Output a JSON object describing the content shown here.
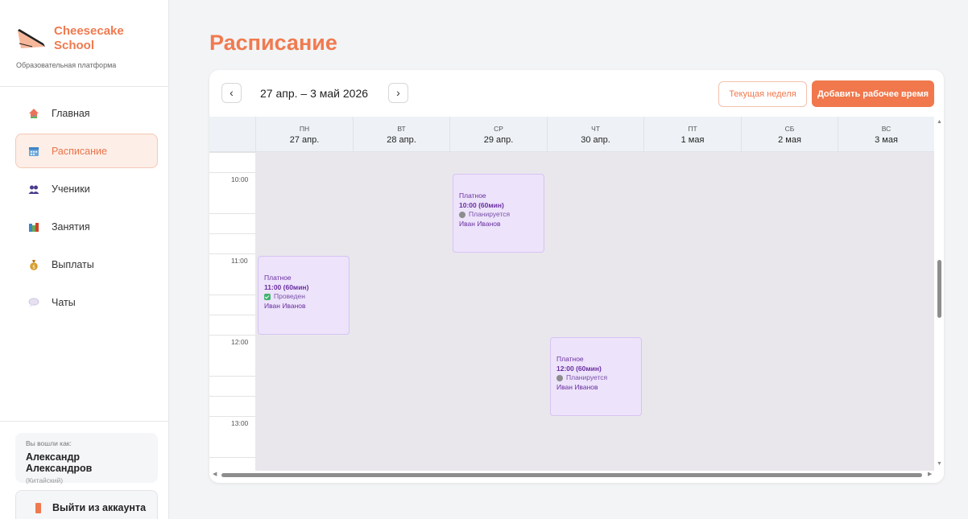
{
  "brand": {
    "name_line1": "Cheesecake",
    "name_line2": "School",
    "subtitle": "Образовательная платформа",
    "accent": "#f07a4f"
  },
  "nav": [
    {
      "label": "Главная",
      "icon": "home-icon",
      "active": false
    },
    {
      "label": "Расписание",
      "icon": "calendar-icon",
      "active": true
    },
    {
      "label": "Ученики",
      "icon": "users-icon",
      "active": false
    },
    {
      "label": "Занятия",
      "icon": "books-icon",
      "active": false
    },
    {
      "label": "Выплаты",
      "icon": "money-bag-icon",
      "active": false
    },
    {
      "label": "Чаты",
      "icon": "chat-icon",
      "active": false
    }
  ],
  "user": {
    "logged_as_label": "Вы вошли как:",
    "name": "Александр Александров",
    "role": "(Китайский)"
  },
  "logout_label": "Выйти из аккаунта",
  "page_title": "Расписание",
  "toolbar": {
    "prev": "‹",
    "next": "›",
    "range": "27 апр. – 3 май 2026",
    "current_week": "Текущая неделя",
    "add_work_time": "Добавить рабочее время"
  },
  "days": [
    {
      "dow": "ПН",
      "date": "27 апр."
    },
    {
      "dow": "ВТ",
      "date": "28 апр."
    },
    {
      "dow": "СР",
      "date": "29 апр."
    },
    {
      "dow": "ЧТ",
      "date": "30 апр."
    },
    {
      "dow": "ПТ",
      "date": "1 мая"
    },
    {
      "dow": "СБ",
      "date": "2 мая"
    },
    {
      "dow": "ВС",
      "date": "3 мая"
    }
  ],
  "times": [
    "10:00",
    "11:00",
    "12:00",
    "13:00"
  ],
  "events": [
    {
      "type": "Платное",
      "time": "10:00 (60мин)",
      "status": "Планируется",
      "status_kind": "planned",
      "student": "Иван Иванов"
    },
    {
      "type": "Платное",
      "time": "11:00 (60мин)",
      "status": "Проведен",
      "status_kind": "done",
      "student": "Иван Иванов"
    },
    {
      "type": "Платное",
      "time": "12:00 (60мин)",
      "status": "Планируется",
      "status_kind": "planned",
      "student": "Иван Иванов"
    }
  ]
}
